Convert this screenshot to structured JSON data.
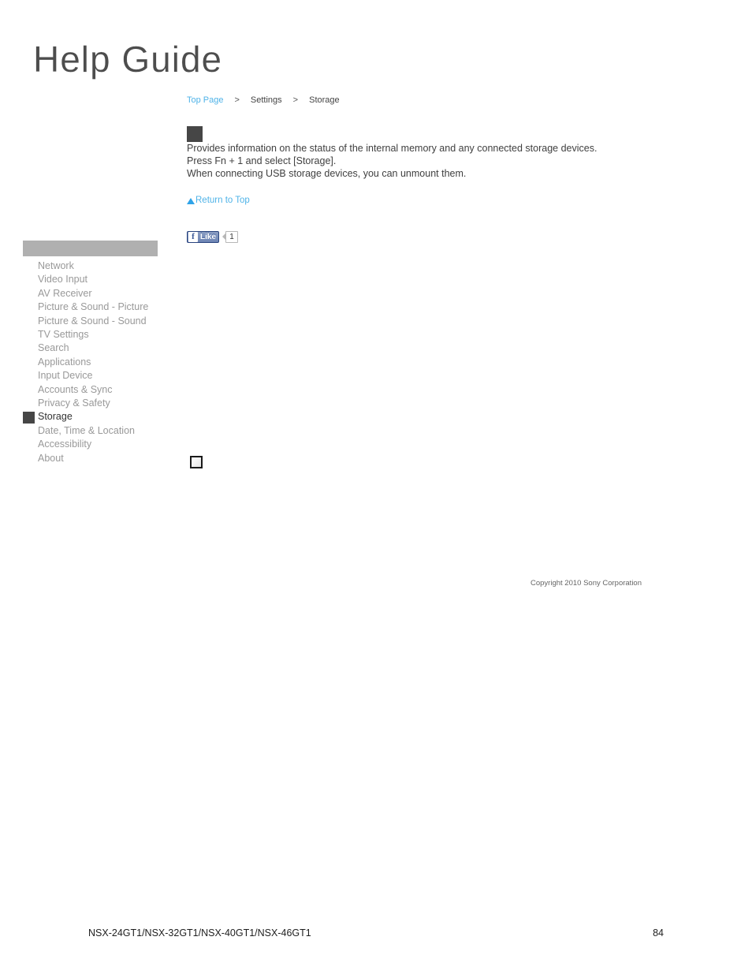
{
  "masthead": {
    "title": "Help Guide"
  },
  "breadcrumb": {
    "top_page": "Top Page",
    "separator_1": ">",
    "settings": "Settings",
    "separator_2": ">",
    "current": "Storage"
  },
  "content": {
    "heading_image_placeholder": "broken-image-placeholder",
    "paragraph_1": "Provides information on the status of the internal memory and any connected storage devices.",
    "paragraph_2": "Press Fn + 1 and select [Storage].",
    "paragraph_3": "When connecting USB storage devices, you can unmount them.",
    "return_to_top": "Return to Top",
    "bottom_image_placeholder": "broken-image-icon"
  },
  "facebook": {
    "f_glyph": "f",
    "like_label": "Like",
    "count": "1"
  },
  "sidebar": {
    "header_label": "",
    "items": [
      {
        "label": "Network",
        "active": false
      },
      {
        "label": "Video Input",
        "active": false
      },
      {
        "label": "AV Receiver",
        "active": false
      },
      {
        "label": "Picture & Sound - Picture",
        "active": false
      },
      {
        "label": "Picture & Sound - Sound",
        "active": false
      },
      {
        "label": "TV Settings",
        "active": false
      },
      {
        "label": "Search",
        "active": false
      },
      {
        "label": "Applications",
        "active": false
      },
      {
        "label": "Input Device",
        "active": false
      },
      {
        "label": "Accounts & Sync",
        "active": false
      },
      {
        "label": "Privacy & Safety",
        "active": false
      },
      {
        "label": "Storage",
        "active": true
      },
      {
        "label": "Date, Time & Location",
        "active": false
      },
      {
        "label": "Accessibility",
        "active": false
      },
      {
        "label": "About",
        "active": false
      }
    ]
  },
  "copyright": "Copyright 2010 Sony Corporation",
  "footer": {
    "models": "NSX-24GT1/NSX-32GT1/NSX-40GT1/NSX-46GT1",
    "page_number": "84"
  },
  "colors": {
    "link_blue": "#4fb3e8",
    "placeholder_dark": "#464646",
    "sidebar_header_gray": "#b0b0b0",
    "sidebar_item_gray": "#999999",
    "facebook_blue": "#3b5998"
  }
}
